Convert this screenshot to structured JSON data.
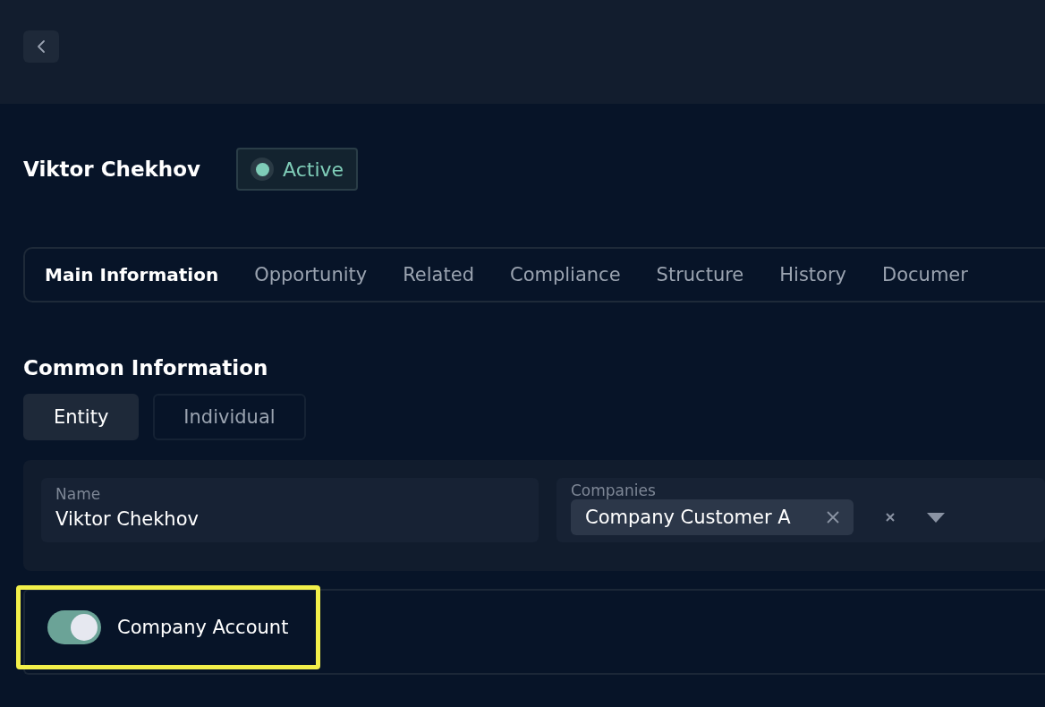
{
  "header": {
    "back_button": true
  },
  "profile": {
    "name": "Viktor Chekhov",
    "status": {
      "label": "Active",
      "color": "#7fcdb8"
    }
  },
  "tabs": [
    {
      "label": "Main Information",
      "selected": true
    },
    {
      "label": "Opportunity",
      "selected": false
    },
    {
      "label": "Related",
      "selected": false
    },
    {
      "label": "Compliance",
      "selected": false
    },
    {
      "label": "Structure",
      "selected": false
    },
    {
      "label": "History",
      "selected": false
    },
    {
      "label": "Documer",
      "selected": false
    }
  ],
  "section": {
    "title": "Common Information",
    "types": [
      {
        "label": "Entity",
        "selected": true
      },
      {
        "label": "Individual",
        "selected": false
      }
    ],
    "name_field": {
      "label": "Name",
      "value": "Viktor Chekhov"
    },
    "companies_field": {
      "label": "Companies",
      "chips": [
        "Company Customer A"
      ]
    },
    "company_account": {
      "label": "Company Account",
      "on": true,
      "highlighted": true
    }
  }
}
